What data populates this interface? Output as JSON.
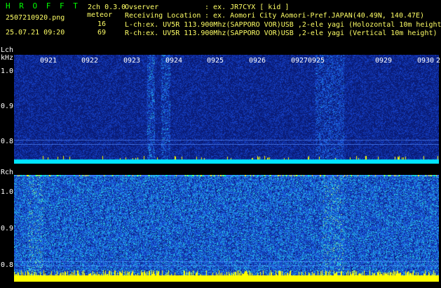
{
  "header": {
    "app_title": "H R O F F T",
    "ch_mode": "2ch 0.3.0",
    "meteor_label": "meteor",
    "filename": "2507210920.png",
    "datetime": "25.07.21 09:20",
    "lch_count": "16",
    "rch_count": "69",
    "observer_label": "Ovserver",
    "observer_value": ": ex. JR7CYX [ kid ]",
    "location_label": "Receiving Location",
    "location_value": ": ex. Aomori City Aomori-Pref.JAPAN(40.49N, 140.47E)",
    "lch_info": "L-ch:ex. UV5R 113.900Mhz(SAPPORO VOR)USB ,2-ele yagi (Holozontal 10m height",
    "rch_info": "R-ch:ex. UV5R 113.900Mhz(SAPPORO VOR)USB ,2-ele yagi (Vertical 10m height)"
  },
  "lch": {
    "label": "Lch",
    "unit": "kHz",
    "y_ticks": [
      "1.0",
      "0.9",
      "0.8"
    ],
    "time_ticks": [
      "0921",
      "0922",
      "0923",
      "0924",
      "0925",
      "0926",
      "0927",
      "0925",
      "0929",
      "0930",
      "2"
    ]
  },
  "rch": {
    "label": "Rch",
    "y_ticks": [
      "1.0",
      "0.9",
      "0.8"
    ]
  },
  "colors": {
    "header_green": "#00ff00",
    "header_yellow": "#ffff66",
    "lch_base": "#0a1a6e",
    "rch_base": "#1a3cc8",
    "baseline_cyan": "#00e5ff",
    "baseline_yellow": "#ffff00"
  }
}
